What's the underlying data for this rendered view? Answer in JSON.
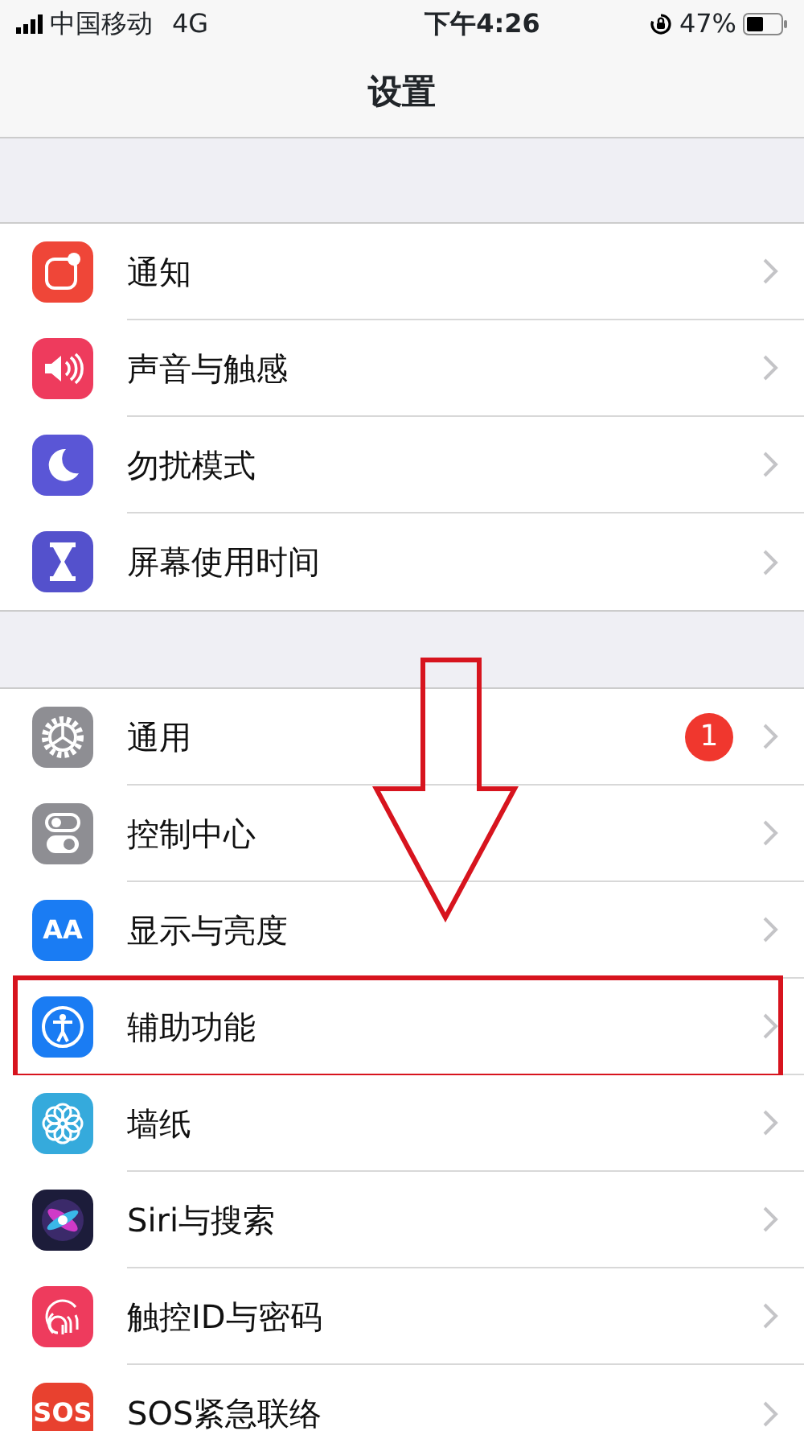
{
  "status_bar": {
    "carrier": "中国移动",
    "network": "4G",
    "time": "下午4:26",
    "battery": "47%"
  },
  "title": "设置",
  "groups": [
    {
      "items": [
        {
          "label": "通知",
          "kind": "notifications",
          "color": "#ef4638",
          "highlighted": false
        },
        {
          "label": "声音与触感",
          "kind": "sound",
          "color": "#ee3b5d",
          "highlighted": false
        },
        {
          "label": "勿扰模式",
          "kind": "moon",
          "color": "#5a56d6",
          "highlighted": false
        },
        {
          "label": "屏幕使用时间",
          "kind": "hourglass",
          "color": "#5451cc",
          "highlighted": false
        }
      ]
    },
    {
      "items": [
        {
          "label": "通用",
          "kind": "gear",
          "color": "#8e8e93",
          "badge": "1",
          "highlighted": false
        },
        {
          "label": "控制中心",
          "kind": "toggles",
          "color": "#8e8e93",
          "highlighted": false
        },
        {
          "label": "显示与亮度",
          "kind": "glyph",
          "glyph": "AA",
          "color": "#1a7cf3",
          "highlighted": false
        },
        {
          "label": "辅助功能",
          "kind": "accessibility",
          "color": "#1a7cf3",
          "highlighted": true
        },
        {
          "label": "墙纸",
          "kind": "flower",
          "color": "#35aadc",
          "highlighted": false
        },
        {
          "label": "Siri与搜索",
          "kind": "siri",
          "color": "#1c1c3a",
          "highlighted": false
        },
        {
          "label": "触控ID与密码",
          "kind": "fingerprint",
          "color": "#ee3b5d",
          "highlighted": false
        },
        {
          "label": "SOS紧急联络",
          "kind": "glyph",
          "glyph": "SOS",
          "color": "#e8412f",
          "highlighted": false
        }
      ]
    }
  ],
  "annotation": {
    "kind": "down-arrow"
  }
}
